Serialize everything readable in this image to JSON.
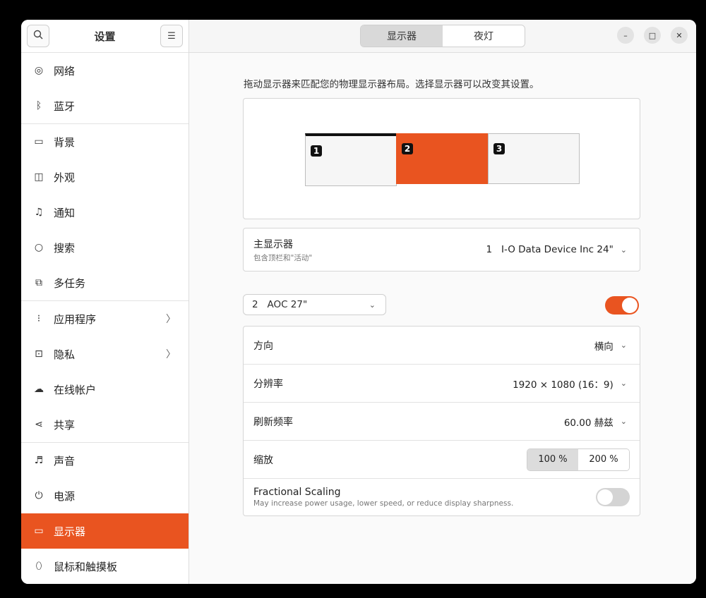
{
  "sidebar": {
    "title": "设置",
    "search_icon": "search-icon",
    "menu_icon": "menu-icon",
    "items": [
      {
        "label": "网络",
        "icon": "network-icon"
      },
      {
        "label": "蓝牙",
        "icon": "bluetooth-icon"
      },
      {
        "label": "背景",
        "icon": "background-icon"
      },
      {
        "label": "外观",
        "icon": "appearance-icon"
      },
      {
        "label": "通知",
        "icon": "bell-icon"
      },
      {
        "label": "搜索",
        "icon": "search-icon"
      },
      {
        "label": "多任务",
        "icon": "multitasking-icon"
      },
      {
        "label": "应用程序",
        "icon": "apps-icon"
      },
      {
        "label": "隐私",
        "icon": "lock-icon"
      },
      {
        "label": "在线帐户",
        "icon": "cloud-icon"
      },
      {
        "label": "共享",
        "icon": "share-icon"
      },
      {
        "label": "声音",
        "icon": "music-icon"
      },
      {
        "label": "电源",
        "icon": "power-icon"
      },
      {
        "label": "显示器",
        "icon": "display-icon"
      },
      {
        "label": "鼠标和触摸板",
        "icon": "mouse-icon"
      }
    ]
  },
  "header": {
    "tabs": [
      "显示器",
      "夜灯"
    ],
    "active_tab": "显示器"
  },
  "display": {
    "description": "拖动显示器来匹配您的物理显示器布局。选择显示器可以改变其设置。",
    "monitors": [
      "1",
      "2",
      "3"
    ],
    "selected_monitor": "2",
    "primary_monitor": "1",
    "primary": {
      "label": "主显示器",
      "sublabel": "包含顶栏和\"活动\"",
      "value": "1   I-O Data Device Inc 24\""
    },
    "selector": {
      "value": "2   AOC 27\"",
      "enabled": true
    },
    "orientation": {
      "label": "方向",
      "value": "横向"
    },
    "resolution": {
      "label": "分辨率",
      "value": "1920 × 1080 (16：9)"
    },
    "refresh": {
      "label": "刷新频率",
      "value": "60.00 赫兹"
    },
    "scale": {
      "label": "缩放",
      "options": [
        "100 %",
        "200 %"
      ],
      "selected": "100 %"
    },
    "fractional": {
      "label": "Fractional Scaling",
      "sublabel": "May increase power usage, lower speed, or reduce display sharpness.",
      "enabled": false
    }
  },
  "colors": {
    "accent": "#e95420"
  }
}
